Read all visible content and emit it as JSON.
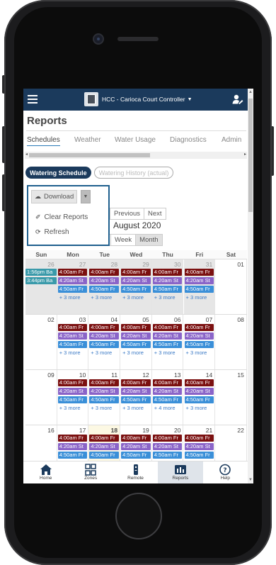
{
  "app": {
    "title": "HCC - Carioca Court Controller"
  },
  "page": {
    "title": "Reports"
  },
  "tabs": [
    {
      "label": "Schedules",
      "active": true
    },
    {
      "label": "Weather"
    },
    {
      "label": "Water Usage"
    },
    {
      "label": "Diagnostics"
    },
    {
      "label": "Admin"
    }
  ],
  "pills": {
    "active": "Watering Schedule",
    "inactive": "Watering History (actual)"
  },
  "download": {
    "label": "Download",
    "items": [
      "Clear Reports",
      "Refresh"
    ]
  },
  "calendar": {
    "month_title": "August 2020",
    "nav": {
      "today_partial": "ay",
      "previous": "Previous",
      "next": "Next"
    },
    "views": {
      "day_partial": "ay",
      "week": "Week",
      "month": "Month",
      "active": "month"
    },
    "weekdays": [
      "Sun",
      "Mon",
      "Tue",
      "Wed",
      "Thu",
      "Fri",
      "Sat"
    ],
    "weeks": [
      [
        "26",
        "27",
        "28",
        "29",
        "30",
        "31",
        "01"
      ],
      [
        "02",
        "03",
        "04",
        "05",
        "06",
        "07",
        "08"
      ],
      [
        "09",
        "10",
        "11",
        "12",
        "13",
        "14",
        "15"
      ],
      [
        "16",
        "17",
        "18",
        "19",
        "20",
        "21",
        "22"
      ]
    ],
    "sunday_events": [
      "1:56pm Ba",
      "3:44pm Ba"
    ],
    "event_labels": [
      "4:00am Fr",
      "4:20am St",
      "4:50am Fr"
    ],
    "more": [
      "+ 3 more",
      "+ 4 more"
    ],
    "colors": {
      "red": "#7b1010",
      "purple": "#8a64c8",
      "blue": "#3a8fd8",
      "teal": "#3a9aaa"
    }
  },
  "bottom_nav": [
    {
      "label": "Home",
      "icon": "home-icon"
    },
    {
      "label": "Zones",
      "icon": "zones-icon"
    },
    {
      "label": "Remote",
      "icon": "remote-icon"
    },
    {
      "label": "Reports",
      "icon": "reports-icon",
      "active": true
    },
    {
      "label": "Help",
      "icon": "help-icon"
    }
  ],
  "colors": {
    "topbar": "#1b3a5c",
    "accent": "#2a7ab8"
  }
}
